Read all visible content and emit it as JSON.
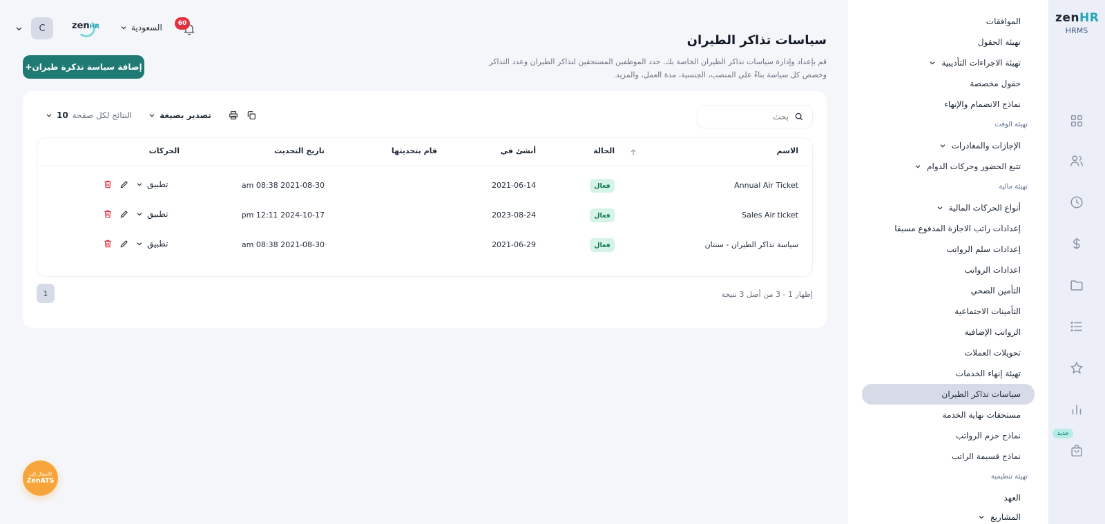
{
  "rail": {
    "logo_zen": "zen",
    "logo_hr": "HR",
    "logo_sub": "HRMS",
    "icons": [
      "dashboard-icon",
      "users-icon",
      "clock-icon",
      "dollar-icon",
      "folder-icon",
      "list-icon",
      "star-icon",
      "chart-icon",
      "bag-icon"
    ],
    "new_badge": "جديد"
  },
  "sidebar": {
    "items": [
      {
        "label": "الموافقات",
        "chevron": false,
        "active": false
      },
      {
        "label": "تهيئة الحقول",
        "chevron": false,
        "active": false
      },
      {
        "label": "تهيئة الاجراءات التأديبية",
        "chevron": true,
        "active": false
      },
      {
        "label": "حقول مخصصة",
        "chevron": false,
        "active": false
      },
      {
        "label": "نماذج الانضمام والإنهاء",
        "chevron": false,
        "active": false
      },
      {
        "label": "الإجازات والمغادرات",
        "chevron": true,
        "active": false
      },
      {
        "label": "تتبع الحضور وحركات الدوام",
        "chevron": true,
        "active": false
      },
      {
        "label": "أنواع الحركات المالية",
        "chevron": true,
        "active": false
      },
      {
        "label": "إعدادات راتب الاجازة المدفوع مسبقا",
        "chevron": false,
        "active": false
      },
      {
        "label": "إعدادات سلم الرواتب",
        "chevron": false,
        "active": false
      },
      {
        "label": "اعدادات الرواتب",
        "chevron": false,
        "active": false
      },
      {
        "label": "التأمين الصحي",
        "chevron": false,
        "active": false
      },
      {
        "label": "التأمينات الاجتماعية",
        "chevron": false,
        "active": false
      },
      {
        "label": "الرواتب الإضافية",
        "chevron": false,
        "active": false
      },
      {
        "label": "تحويلات العملات",
        "chevron": false,
        "active": false
      },
      {
        "label": "تهيئة إنهاء الخدمات",
        "chevron": false,
        "active": false
      },
      {
        "label": "سياسات تذاكر الطيران",
        "chevron": false,
        "active": true
      },
      {
        "label": "مستحقات نهاية الخدمة",
        "chevron": false,
        "active": false
      },
      {
        "label": "نماذج حزم الرواتب",
        "chevron": false,
        "active": false
      },
      {
        "label": "نماذج قسيمة الراتب",
        "chevron": false,
        "active": false
      },
      {
        "label": "العهد",
        "chevron": false,
        "active": false
      },
      {
        "label": "المشاريع",
        "chevron": true,
        "active": false
      }
    ],
    "sections": [
      "تهيئة الوقت",
      "تهيئة مالية",
      "تهيئة تنظيمية"
    ]
  },
  "topbar": {
    "avatar_letter": "C",
    "company_logo": "zen",
    "company_logo_hr": "HR",
    "country": "السعودية",
    "notifications": "60"
  },
  "header": {
    "title": "سياسات تذاكر الطيران",
    "description": "قم بإعداد وإدارة سياسات تذاكر الطيران الخاصة بك. حدد الموظفين المستحقين لتذاكر الطيران وعدد التذاكر وخصص كل سياسة بناءً على المنصب، الجنسية، مدة العمل، والمزيد.",
    "add_button": "+إضافة سياسة تذكرة طيران"
  },
  "toolbar": {
    "search_placeholder": "بحث",
    "export_label": "تصدير بصيغة",
    "per_page_label": "النتائج لكل صفحة",
    "per_page_value": "10"
  },
  "table": {
    "columns": {
      "name": "الاسم",
      "status": "الحالة",
      "created": "أنشئ في",
      "updated_by": "قام بتحديثها",
      "updated_at": "تاريخ التحديث",
      "actions": "الحركات"
    },
    "rows": [
      {
        "name": "Annual Air Ticket",
        "status": "فعال",
        "created": "2021-06-14",
        "updated_by": "",
        "updated_at": "am 08:38 2021-08-30",
        "action": "تطبيق"
      },
      {
        "name": "Sales Air ticket",
        "status": "فعال",
        "created": "2023-08-24",
        "updated_by": "",
        "updated_at": "pm 12:11 2024-10-17",
        "action": "تطبيق"
      },
      {
        "name": "سياسة تذاكر الطيران - سنتان",
        "status": "فعال",
        "created": "2021-06-29",
        "updated_by": "",
        "updated_at": "am 08:38 2021-08-30",
        "action": "تطبيق"
      }
    ]
  },
  "pagination": {
    "current_page": "1",
    "summary": "إظهار 1 - 3 من أصل 3 نتيجة"
  },
  "ats": {
    "line1": "الانتقال إلى",
    "line2": "ZenATS"
  },
  "colors": {
    "accent": "#1f7a74",
    "badge_red": "#e03140",
    "status_bg": "#d6f3e8",
    "status_text": "#137a55",
    "ats_orange": "#f7a53b"
  }
}
